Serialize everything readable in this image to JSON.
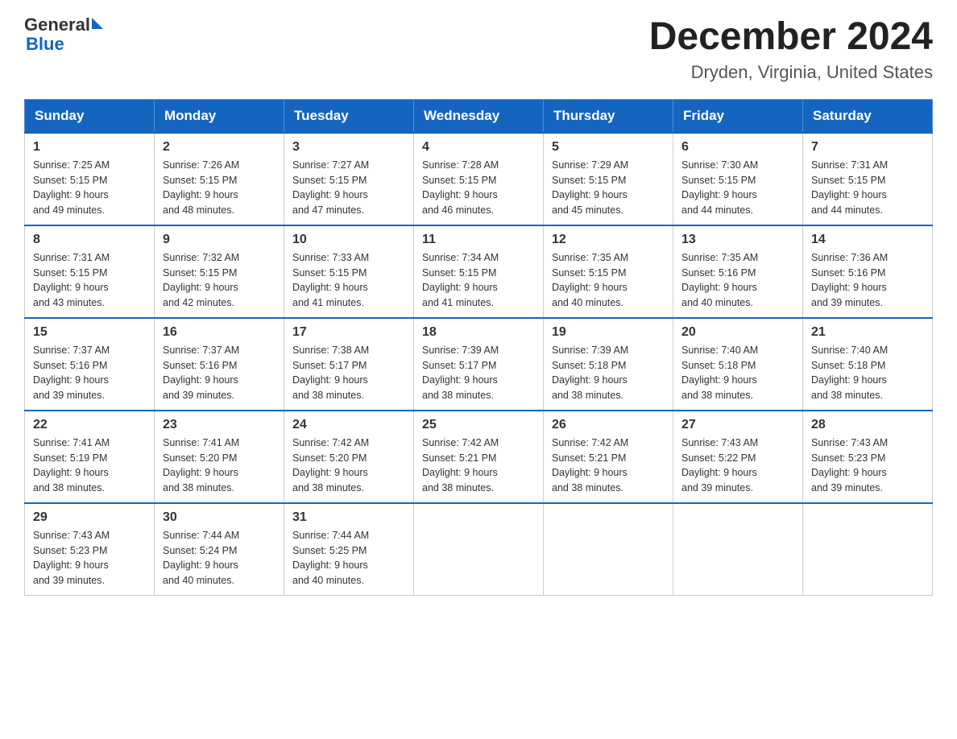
{
  "header": {
    "logo_general": "General",
    "logo_blue": "Blue",
    "month_title": "December 2024",
    "location": "Dryden, Virginia, United States"
  },
  "days_of_week": [
    "Sunday",
    "Monday",
    "Tuesday",
    "Wednesday",
    "Thursday",
    "Friday",
    "Saturday"
  ],
  "weeks": [
    [
      {
        "num": "1",
        "sunrise": "7:25 AM",
        "sunset": "5:15 PM",
        "daylight": "9 hours and 49 minutes."
      },
      {
        "num": "2",
        "sunrise": "7:26 AM",
        "sunset": "5:15 PM",
        "daylight": "9 hours and 48 minutes."
      },
      {
        "num": "3",
        "sunrise": "7:27 AM",
        "sunset": "5:15 PM",
        "daylight": "9 hours and 47 minutes."
      },
      {
        "num": "4",
        "sunrise": "7:28 AM",
        "sunset": "5:15 PM",
        "daylight": "9 hours and 46 minutes."
      },
      {
        "num": "5",
        "sunrise": "7:29 AM",
        "sunset": "5:15 PM",
        "daylight": "9 hours and 45 minutes."
      },
      {
        "num": "6",
        "sunrise": "7:30 AM",
        "sunset": "5:15 PM",
        "daylight": "9 hours and 44 minutes."
      },
      {
        "num": "7",
        "sunrise": "7:31 AM",
        "sunset": "5:15 PM",
        "daylight": "9 hours and 44 minutes."
      }
    ],
    [
      {
        "num": "8",
        "sunrise": "7:31 AM",
        "sunset": "5:15 PM",
        "daylight": "9 hours and 43 minutes."
      },
      {
        "num": "9",
        "sunrise": "7:32 AM",
        "sunset": "5:15 PM",
        "daylight": "9 hours and 42 minutes."
      },
      {
        "num": "10",
        "sunrise": "7:33 AM",
        "sunset": "5:15 PM",
        "daylight": "9 hours and 41 minutes."
      },
      {
        "num": "11",
        "sunrise": "7:34 AM",
        "sunset": "5:15 PM",
        "daylight": "9 hours and 41 minutes."
      },
      {
        "num": "12",
        "sunrise": "7:35 AM",
        "sunset": "5:15 PM",
        "daylight": "9 hours and 40 minutes."
      },
      {
        "num": "13",
        "sunrise": "7:35 AM",
        "sunset": "5:16 PM",
        "daylight": "9 hours and 40 minutes."
      },
      {
        "num": "14",
        "sunrise": "7:36 AM",
        "sunset": "5:16 PM",
        "daylight": "9 hours and 39 minutes."
      }
    ],
    [
      {
        "num": "15",
        "sunrise": "7:37 AM",
        "sunset": "5:16 PM",
        "daylight": "9 hours and 39 minutes."
      },
      {
        "num": "16",
        "sunrise": "7:37 AM",
        "sunset": "5:16 PM",
        "daylight": "9 hours and 39 minutes."
      },
      {
        "num": "17",
        "sunrise": "7:38 AM",
        "sunset": "5:17 PM",
        "daylight": "9 hours and 38 minutes."
      },
      {
        "num": "18",
        "sunrise": "7:39 AM",
        "sunset": "5:17 PM",
        "daylight": "9 hours and 38 minutes."
      },
      {
        "num": "19",
        "sunrise": "7:39 AM",
        "sunset": "5:18 PM",
        "daylight": "9 hours and 38 minutes."
      },
      {
        "num": "20",
        "sunrise": "7:40 AM",
        "sunset": "5:18 PM",
        "daylight": "9 hours and 38 minutes."
      },
      {
        "num": "21",
        "sunrise": "7:40 AM",
        "sunset": "5:18 PM",
        "daylight": "9 hours and 38 minutes."
      }
    ],
    [
      {
        "num": "22",
        "sunrise": "7:41 AM",
        "sunset": "5:19 PM",
        "daylight": "9 hours and 38 minutes."
      },
      {
        "num": "23",
        "sunrise": "7:41 AM",
        "sunset": "5:20 PM",
        "daylight": "9 hours and 38 minutes."
      },
      {
        "num": "24",
        "sunrise": "7:42 AM",
        "sunset": "5:20 PM",
        "daylight": "9 hours and 38 minutes."
      },
      {
        "num": "25",
        "sunrise": "7:42 AM",
        "sunset": "5:21 PM",
        "daylight": "9 hours and 38 minutes."
      },
      {
        "num": "26",
        "sunrise": "7:42 AM",
        "sunset": "5:21 PM",
        "daylight": "9 hours and 38 minutes."
      },
      {
        "num": "27",
        "sunrise": "7:43 AM",
        "sunset": "5:22 PM",
        "daylight": "9 hours and 39 minutes."
      },
      {
        "num": "28",
        "sunrise": "7:43 AM",
        "sunset": "5:23 PM",
        "daylight": "9 hours and 39 minutes."
      }
    ],
    [
      {
        "num": "29",
        "sunrise": "7:43 AM",
        "sunset": "5:23 PM",
        "daylight": "9 hours and 39 minutes."
      },
      {
        "num": "30",
        "sunrise": "7:44 AM",
        "sunset": "5:24 PM",
        "daylight": "9 hours and 40 minutes."
      },
      {
        "num": "31",
        "sunrise": "7:44 AM",
        "sunset": "5:25 PM",
        "daylight": "9 hours and 40 minutes."
      },
      null,
      null,
      null,
      null
    ]
  ],
  "labels": {
    "sunrise": "Sunrise:",
    "sunset": "Sunset:",
    "daylight": "Daylight:"
  }
}
